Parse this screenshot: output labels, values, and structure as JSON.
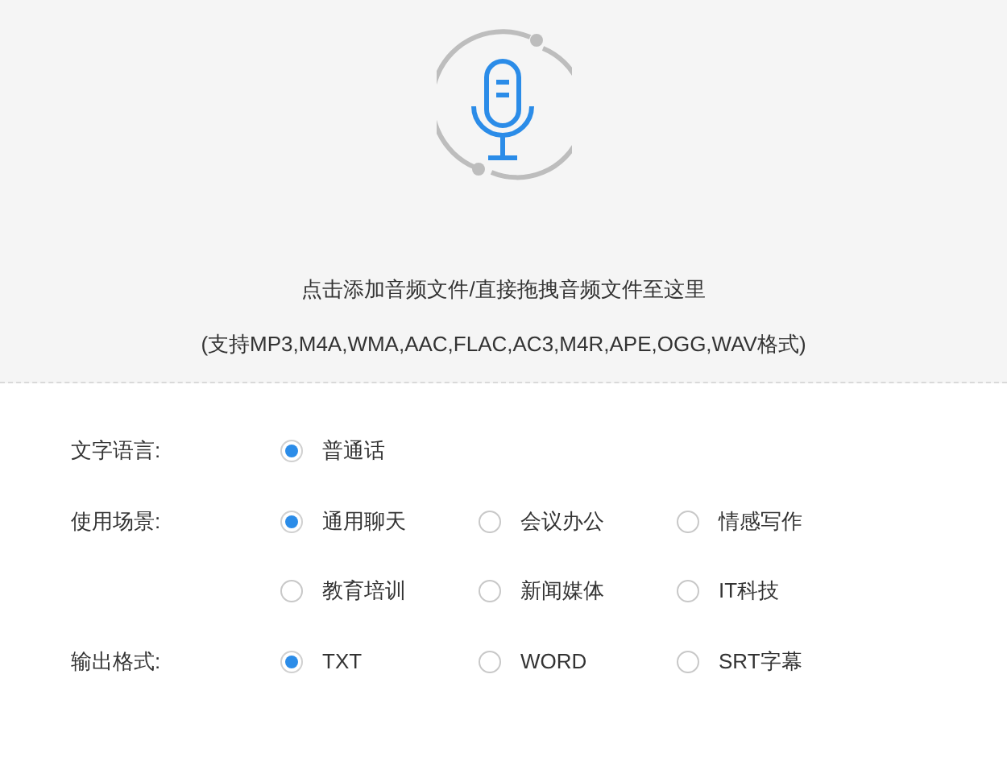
{
  "upload": {
    "instruction": "点击添加音频文件/直接拖拽音频文件至这里",
    "formats": "(支持MP3,M4A,WMA,AAC,FLAC,AC3,M4R,APE,OGG,WAV格式)"
  },
  "settings": [
    {
      "label": "文字语言:",
      "options": [
        {
          "label": "普通话",
          "selected": true
        }
      ]
    },
    {
      "label": "使用场景:",
      "options": [
        {
          "label": "通用聊天",
          "selected": true
        },
        {
          "label": "会议办公",
          "selected": false
        },
        {
          "label": "情感写作",
          "selected": false
        },
        {
          "label": "教育培训",
          "selected": false
        },
        {
          "label": "新闻媒体",
          "selected": false
        },
        {
          "label": "IT科技",
          "selected": false
        }
      ]
    },
    {
      "label": "输出格式:",
      "options": [
        {
          "label": "TXT",
          "selected": true
        },
        {
          "label": "WORD",
          "selected": false
        },
        {
          "label": "SRT字幕",
          "selected": false
        }
      ]
    }
  ]
}
